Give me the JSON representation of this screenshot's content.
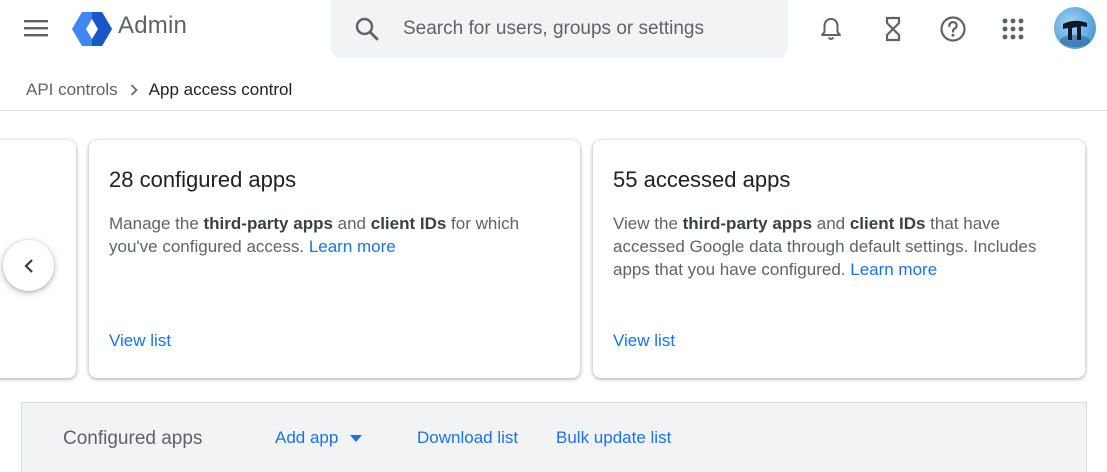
{
  "header": {
    "app_name": "Admin",
    "search_placeholder": "Search for users, groups or settings",
    "icons": [
      "menu-icon",
      "admin-logo",
      "search-icon",
      "bell-icon",
      "hourglass-icon",
      "help-icon",
      "apps-grid-icon",
      "avatar"
    ],
    "colors": {
      "logo_blue": "#4285f4",
      "logo_dark": "#1a56c8"
    }
  },
  "breadcrumb": {
    "parent": "API controls",
    "current": "App access control"
  },
  "cards": [
    {
      "title": "28 configured apps",
      "desc_pre": "Manage the ",
      "desc_b1": "third-party apps",
      "desc_mid": " and ",
      "desc_b2": "client IDs",
      "desc_post": " for which you've configured access.",
      "learn_more": "Learn more",
      "action": "View list"
    },
    {
      "title": "55 accessed apps",
      "desc_pre": "View the ",
      "desc_b1": "third-party apps",
      "desc_mid": " and ",
      "desc_b2": "client IDs",
      "desc_post": " that have accessed Google data through default settings. Includes apps that you have configured.",
      "learn_more": "Learn more",
      "action": "View list"
    }
  ],
  "toolbar": {
    "title": "Configured apps",
    "add_app": "Add app",
    "download_list": "Download list",
    "bulk_update": "Bulk update list"
  },
  "colors": {
    "link": "#1a73e8",
    "text_secondary": "#5f6368",
    "toolbar_bg": "#f1f3f4"
  }
}
